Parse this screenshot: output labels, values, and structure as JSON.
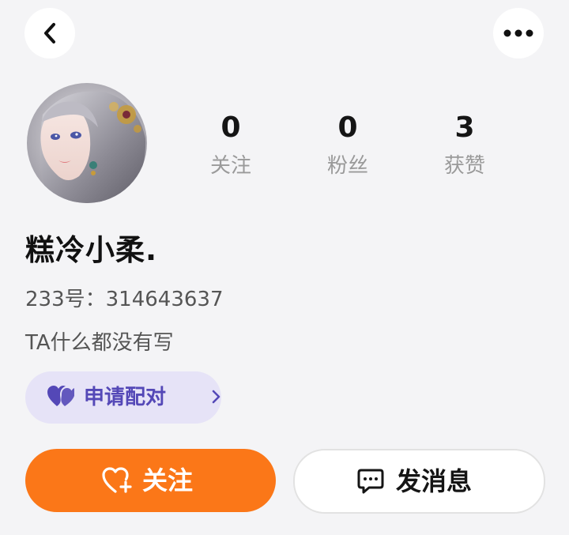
{
  "nav": {
    "back_icon": "chevron-left-icon",
    "more_icon": "more-horizontal-icon"
  },
  "profile": {
    "avatar": "avatar-image",
    "nickname": "糕冷小柔.",
    "user_id": "233号：314643637",
    "bio": "TA什么都没有写"
  },
  "stats": {
    "following": {
      "value": "0",
      "label": "关注"
    },
    "fans": {
      "value": "0",
      "label": "粉丝"
    },
    "likes": {
      "value": "3",
      "label": "获赞"
    }
  },
  "pair": {
    "label": "申请配对",
    "icon": "double-heart-icon",
    "chevron_icon": "chevron-right-icon",
    "color": "#5448b7",
    "bg": "#e6e3f7"
  },
  "actions": {
    "follow": {
      "label": "关注",
      "icon": "heart-plus-icon",
      "bg": "#fb7718"
    },
    "message": {
      "label": "发消息",
      "icon": "chat-bubble-icon"
    }
  }
}
